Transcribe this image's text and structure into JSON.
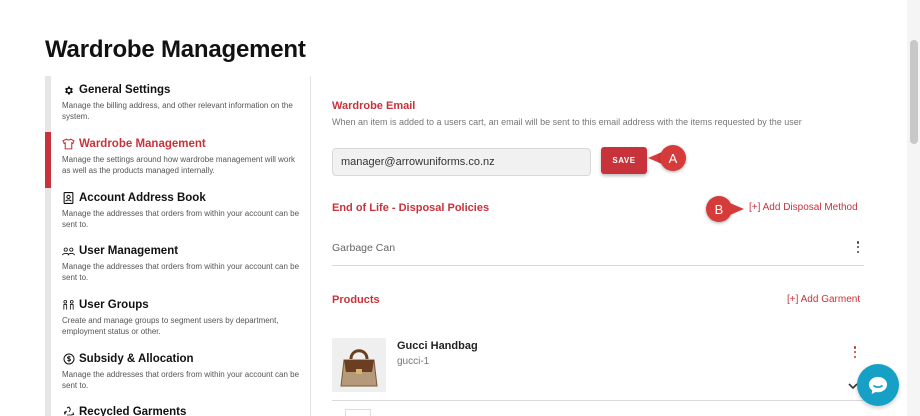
{
  "page": {
    "title": "Wardrobe Management"
  },
  "colors": {
    "accent": "#c8333b",
    "chat": "#17a0c6",
    "callout": "#d63b3b"
  },
  "sidebar": {
    "items": [
      {
        "label": "General Settings",
        "icon": "gear-icon",
        "desc": "Manage the billing address, and other relevant information on the system."
      },
      {
        "label": "Wardrobe Management",
        "icon": "shirt-icon",
        "desc": "Manage the settings around how wardrobe management will work as well as the products managed internally.",
        "active": true
      },
      {
        "label": "Account Address Book",
        "icon": "address-book-icon",
        "desc": "Manage the addresses that orders from within your account can be sent to."
      },
      {
        "label": "User Management",
        "icon": "users-icon",
        "desc": "Manage the addresses that orders from within your account can be sent to."
      },
      {
        "label": "User Groups",
        "icon": "user-groups-icon",
        "desc": "Create and manage groups to segment users by department, employment status or other."
      },
      {
        "label": "Subsidy & Allocation",
        "icon": "dollar-circle-icon",
        "desc": "Manage the addresses that orders from within your account can be sent to."
      },
      {
        "label": "Recycled Garments",
        "icon": "recycle-icon",
        "desc": ""
      }
    ]
  },
  "wardrobe_email": {
    "title": "Wardrobe Email",
    "description": "When an item is added to a users cart, an email will be sent to this email address with the items requested by the user",
    "value": "manager@arrowuniforms.co.nz",
    "save_label": "SAVE"
  },
  "callouts": {
    "a": "A",
    "b": "B"
  },
  "disposal": {
    "title": "End of Life - Disposal Policies",
    "add_label": "[+] Add Disposal Method",
    "items": [
      "Garbage Can"
    ]
  },
  "products": {
    "title": "Products",
    "add_label": "[+] Add Garment",
    "items": [
      {
        "name": "Gucci Handbag",
        "sku": "gucci-1"
      }
    ]
  }
}
